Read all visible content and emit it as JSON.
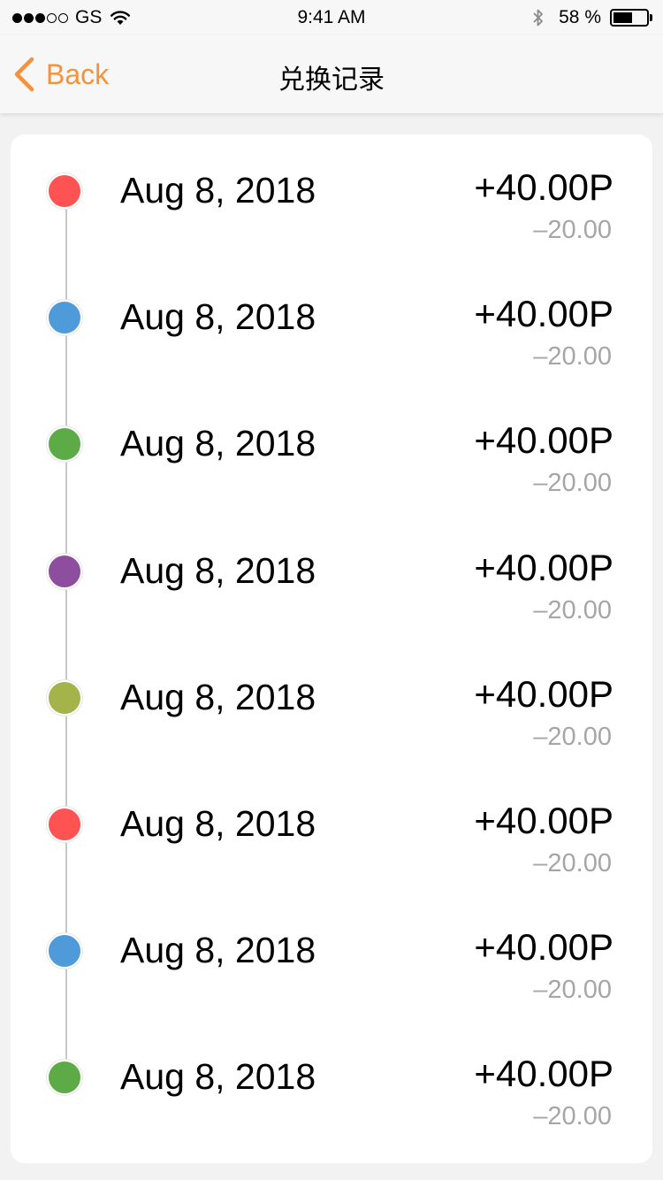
{
  "status_bar": {
    "carrier": "GS",
    "time": "9:41 AM",
    "battery": "58 %",
    "battery_level": 0.58,
    "signal_dots_filled": 3,
    "signal_dots_total": 5
  },
  "nav": {
    "back_label": "Back",
    "title": "兑换记录",
    "accent_color": "#f7923a"
  },
  "records": [
    {
      "date": "Aug 8, 2018",
      "amount": "+40.00P",
      "delta": "–20.00",
      "color": "#ff5252"
    },
    {
      "date": "Aug 8, 2018",
      "amount": "+40.00P",
      "delta": "–20.00",
      "color": "#4f9bd9"
    },
    {
      "date": "Aug 8, 2018",
      "amount": "+40.00P",
      "delta": "–20.00",
      "color": "#5cab47"
    },
    {
      "date": "Aug 8, 2018",
      "amount": "+40.00P",
      "delta": "–20.00",
      "color": "#8e4ea0"
    },
    {
      "date": "Aug 8, 2018",
      "amount": "+40.00P",
      "delta": "–20.00",
      "color": "#a4b44a"
    },
    {
      "date": "Aug 8, 2018",
      "amount": "+40.00P",
      "delta": "–20.00",
      "color": "#ff5252"
    },
    {
      "date": "Aug 8, 2018",
      "amount": "+40.00P",
      "delta": "–20.00",
      "color": "#4f9bd9"
    },
    {
      "date": "Aug 8, 2018",
      "amount": "+40.00P",
      "delta": "–20.00",
      "color": "#5cab47"
    }
  ]
}
